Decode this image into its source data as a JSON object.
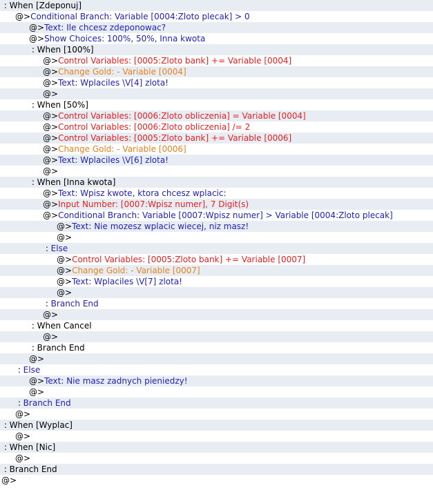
{
  "colors": {
    "black": "#000000",
    "blue": "#1f1fb4",
    "red": "#e61e1e",
    "orange": "#e6821e",
    "stripe": "#e8edf3"
  },
  "lines": [
    {
      "indent": 0,
      "prefix": " : ",
      "text": "When [Zdeponuj]",
      "color": "black"
    },
    {
      "indent": 1,
      "prefix": "@>",
      "text": "Conditional Branch: Variable [0004:Zloto plecak] > 0",
      "color": "blue"
    },
    {
      "indent": 2,
      "prefix": "@>",
      "text": "Text: Ile chcesz zdeponowac?",
      "color": "blue"
    },
    {
      "indent": 2,
      "prefix": "@>",
      "text": "Show Choices: 100%, 50%, Inna kwota",
      "color": "blue"
    },
    {
      "indent": 2,
      "prefix": " : ",
      "text": "When [100%]",
      "color": "black"
    },
    {
      "indent": 3,
      "prefix": "@>",
      "text": "Control Variables: [0005:Zloto bank] += Variable [0004]",
      "color": "red"
    },
    {
      "indent": 3,
      "prefix": "@>",
      "text": "Change Gold: - Variable [0004]",
      "color": "orange"
    },
    {
      "indent": 3,
      "prefix": "@>",
      "text": "Text: Wplaciles \\V[4] zlota!",
      "color": "blue"
    },
    {
      "indent": 3,
      "prefix": "@>",
      "text": "",
      "color": "black"
    },
    {
      "indent": 2,
      "prefix": " : ",
      "text": "When [50%]",
      "color": "black"
    },
    {
      "indent": 3,
      "prefix": "@>",
      "text": "Control Variables: [0006:Zloto obliczenia] = Variable [0004]",
      "color": "red"
    },
    {
      "indent": 3,
      "prefix": "@>",
      "text": "Control Variables: [0006:Zloto obliczenia] /= 2",
      "color": "red"
    },
    {
      "indent": 3,
      "prefix": "@>",
      "text": "Control Variables: [0005:Zloto bank] += Variable [0006]",
      "color": "red"
    },
    {
      "indent": 3,
      "prefix": "@>",
      "text": "Change Gold: - Variable [0006]",
      "color": "orange"
    },
    {
      "indent": 3,
      "prefix": "@>",
      "text": "Text: Wplaciles \\V[6] zlota!",
      "color": "blue"
    },
    {
      "indent": 3,
      "prefix": "@>",
      "text": "",
      "color": "black"
    },
    {
      "indent": 2,
      "prefix": " : ",
      "text": "When [Inna kwota]",
      "color": "black"
    },
    {
      "indent": 3,
      "prefix": "@>",
      "text": "Text: Wpisz kwote, ktora chcesz wplacic:",
      "color": "blue"
    },
    {
      "indent": 3,
      "prefix": "@>",
      "text": "Input Number: [0007:Wpisz numer], 7 Digit(s)",
      "color": "red"
    },
    {
      "indent": 3,
      "prefix": "@>",
      "text": "Conditional Branch: Variable [0007:Wpisz numer] > Variable [0004:Zloto plecak]",
      "color": "blue"
    },
    {
      "indent": 4,
      "prefix": "@>",
      "text": "Text: Nie mozesz wplacic wiecej, niz masz!",
      "color": "blue"
    },
    {
      "indent": 4,
      "prefix": "@>",
      "text": "",
      "color": "black"
    },
    {
      "indent": 3,
      "prefix": " : ",
      "text": "Else",
      "color": "blue"
    },
    {
      "indent": 4,
      "prefix": "@>",
      "text": "Control Variables: [0005:Zloto bank] += Variable [0007]",
      "color": "red"
    },
    {
      "indent": 4,
      "prefix": "@>",
      "text": "Change Gold: - Variable [0007]",
      "color": "orange"
    },
    {
      "indent": 4,
      "prefix": "@>",
      "text": "Text: Wplaciles \\V[7] zlota!",
      "color": "blue"
    },
    {
      "indent": 4,
      "prefix": "@>",
      "text": "",
      "color": "black"
    },
    {
      "indent": 3,
      "prefix": " : ",
      "text": "Branch End",
      "color": "blue"
    },
    {
      "indent": 3,
      "prefix": "@>",
      "text": "",
      "color": "black"
    },
    {
      "indent": 2,
      "prefix": " : ",
      "text": "When Cancel",
      "color": "black"
    },
    {
      "indent": 3,
      "prefix": "@>",
      "text": "",
      "color": "black"
    },
    {
      "indent": 2,
      "prefix": " : ",
      "text": "Branch End",
      "color": "black"
    },
    {
      "indent": 2,
      "prefix": "@>",
      "text": "",
      "color": "black"
    },
    {
      "indent": 1,
      "prefix": " : ",
      "text": "Else",
      "color": "blue"
    },
    {
      "indent": 2,
      "prefix": "@>",
      "text": "Text: Nie masz zadnych pieniedzy!",
      "color": "blue"
    },
    {
      "indent": 2,
      "prefix": "@>",
      "text": "",
      "color": "black"
    },
    {
      "indent": 1,
      "prefix": " : ",
      "text": "Branch End",
      "color": "blue"
    },
    {
      "indent": 1,
      "prefix": "@>",
      "text": "",
      "color": "black"
    },
    {
      "indent": 0,
      "prefix": " : ",
      "text": "When [Wyplac]",
      "color": "black"
    },
    {
      "indent": 1,
      "prefix": "@>",
      "text": "",
      "color": "black"
    },
    {
      "indent": 0,
      "prefix": " : ",
      "text": "When [Nic]",
      "color": "black"
    },
    {
      "indent": 1,
      "prefix": "@>",
      "text": "",
      "color": "black"
    },
    {
      "indent": 0,
      "prefix": " : ",
      "text": "Branch End",
      "color": "black"
    },
    {
      "indent": 0,
      "prefix": "@>",
      "text": "",
      "color": "black"
    }
  ]
}
